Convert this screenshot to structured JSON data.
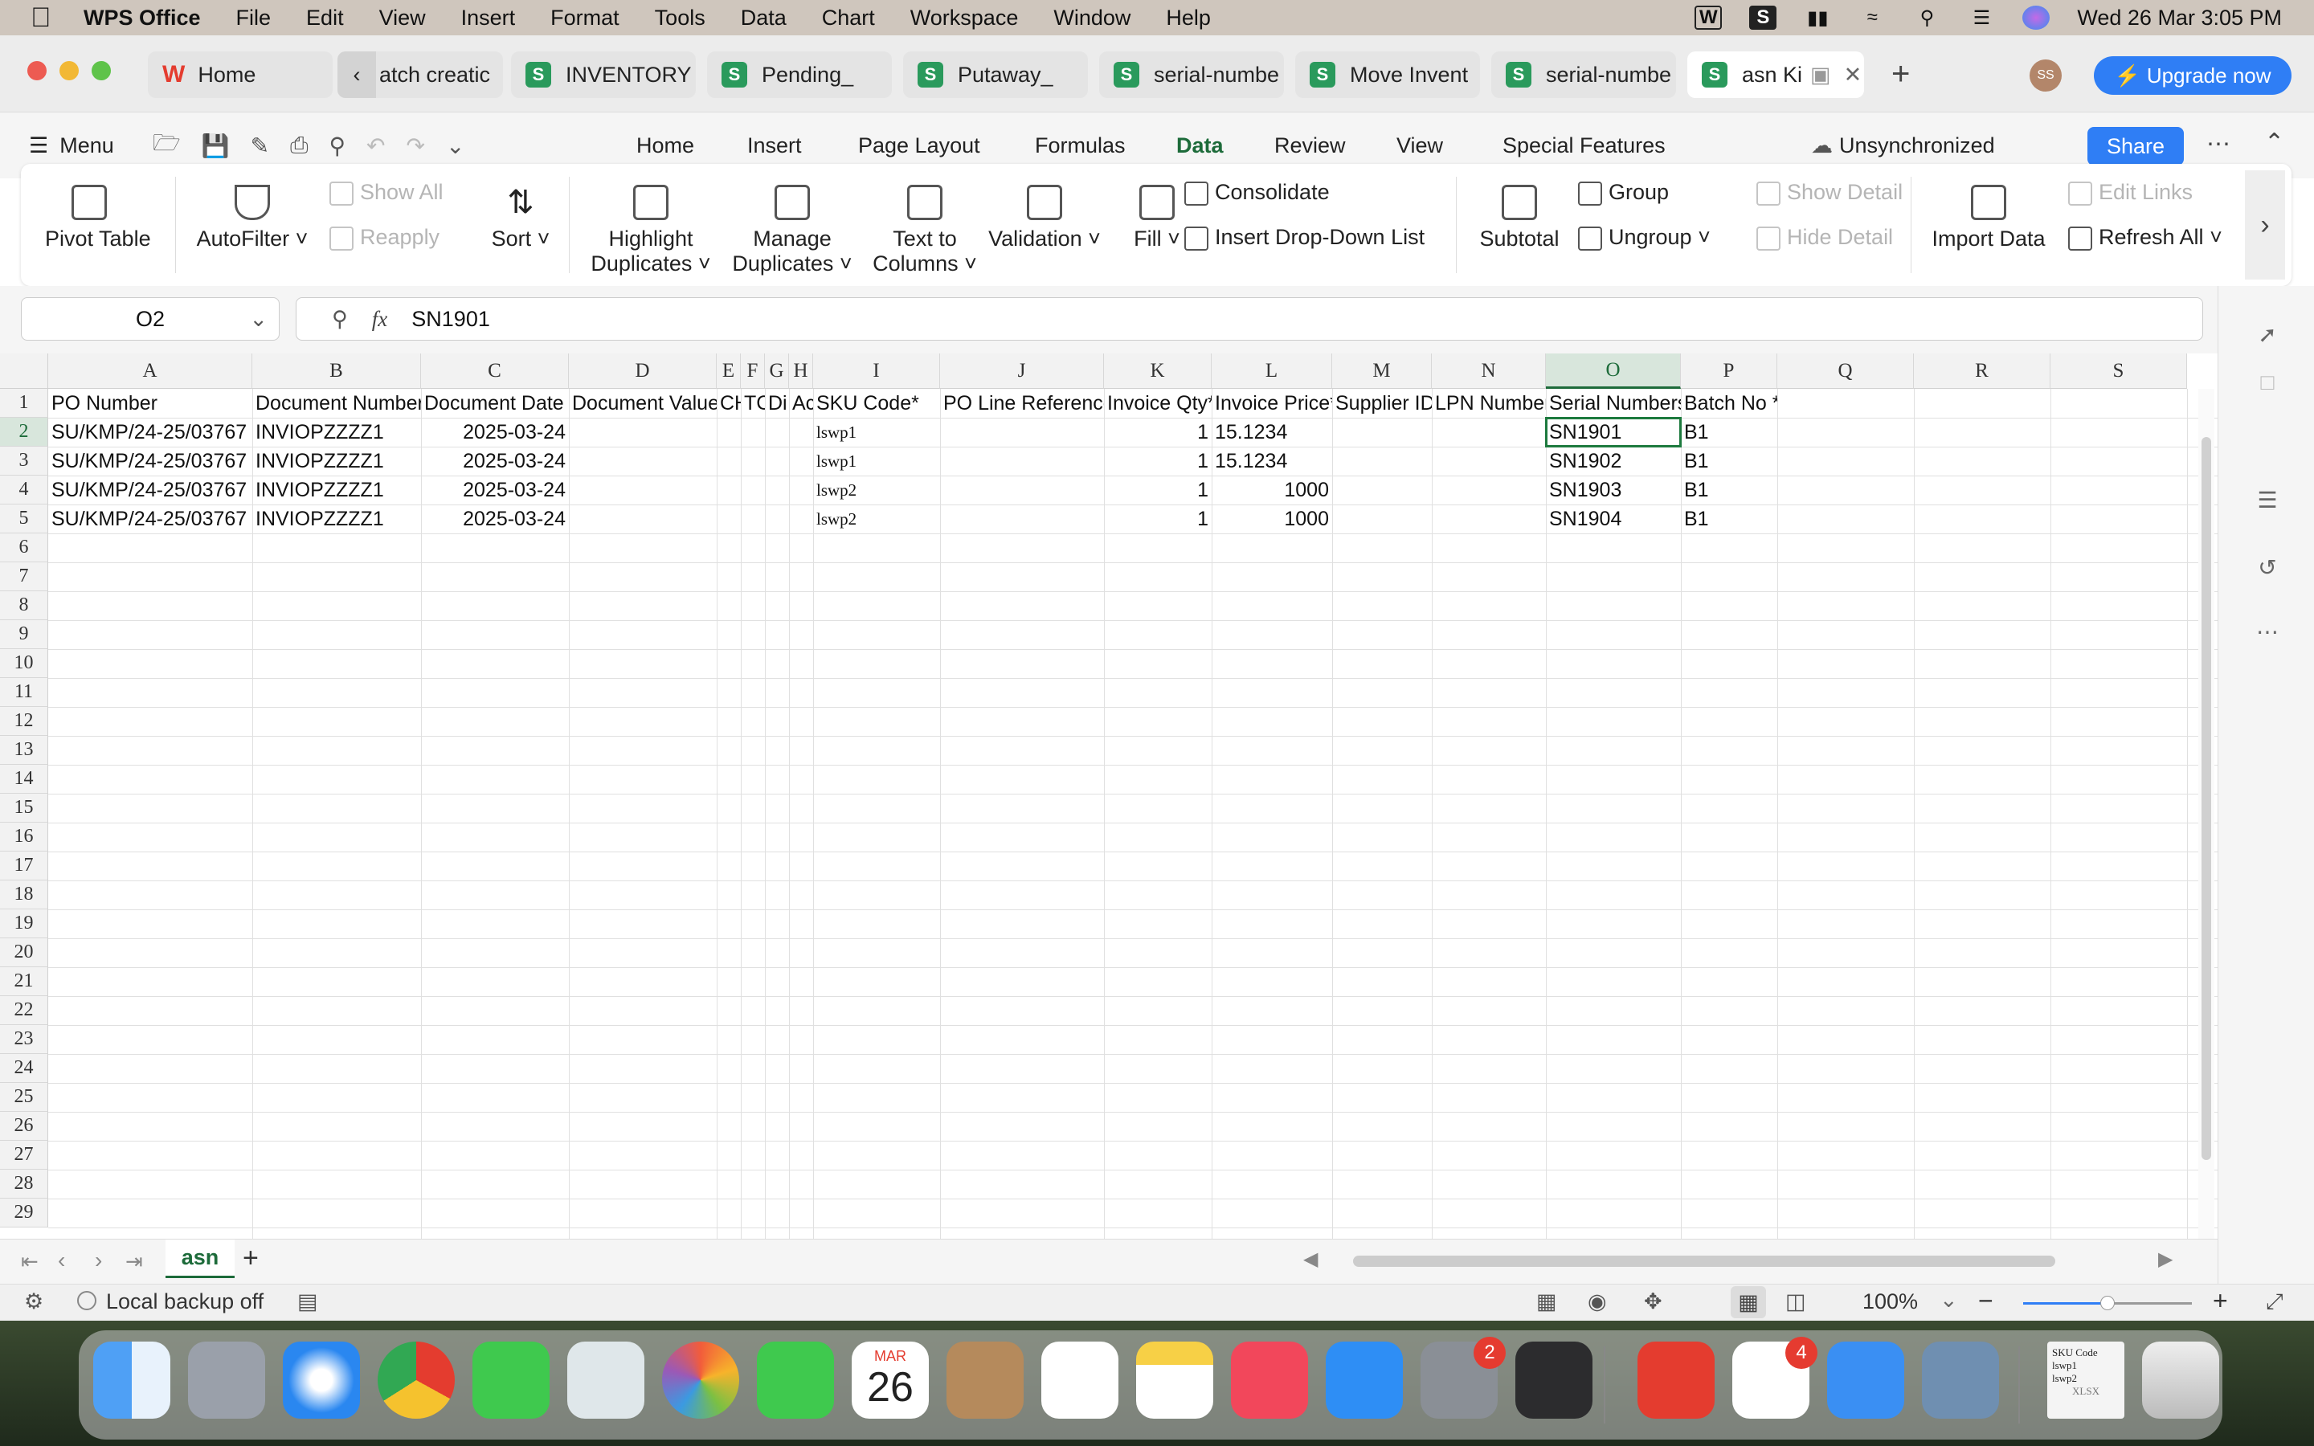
{
  "menubar": {
    "app_name": "WPS Office",
    "items": [
      "File",
      "Edit",
      "View",
      "Insert",
      "Format",
      "Tools",
      "Data",
      "Chart",
      "Workspace",
      "Window",
      "Help"
    ],
    "datetime": "Wed 26 Mar  3:05 PM"
  },
  "tabs": [
    {
      "label": "Home"
    },
    {
      "label": "atch creatic"
    },
    {
      "label": "INVENTORY"
    },
    {
      "label": "Pending_"
    },
    {
      "label": "Putaway_"
    },
    {
      "label": "serial-numbe"
    },
    {
      "label": "Move Invent"
    },
    {
      "label": "serial-numbe"
    },
    {
      "label": "asn Ki"
    }
  ],
  "account": {
    "avatar": "SS",
    "upgrade": "Upgrade now"
  },
  "toolbar": {
    "menu": "Menu",
    "ribbon_tabs": [
      "Home",
      "Insert",
      "Page Layout",
      "Formulas",
      "Data",
      "Review",
      "View",
      "Special Features"
    ],
    "sync_status": "Unsynchronized",
    "share": "Share"
  },
  "ribbon": {
    "pivot": "Pivot Table",
    "autofilter": "AutoFilter",
    "show_all": "Show All",
    "reapply": "Reapply",
    "sort": "Sort",
    "highlight_1": "Highlight",
    "highlight_2": "Duplicates",
    "manage_1": "Manage",
    "manage_2": "Duplicates",
    "text_1": "Text to",
    "text_2": "Columns",
    "validation": "Validation",
    "fill": "Fill",
    "consolidate": "Consolidate",
    "dropdown": "Insert Drop-Down List",
    "subtotal": "Subtotal",
    "group": "Group",
    "ungroup": "Ungroup",
    "show_detail": "Show Detail",
    "hide_detail": "Hide Detail",
    "import": "Import Data",
    "edit_links": "Edit Links",
    "refresh": "Refresh All"
  },
  "formula_bar": {
    "cell_ref": "O2",
    "fx": "fx",
    "content": "SN1901"
  },
  "columns": [
    "A",
    "B",
    "C",
    "D",
    "E",
    "F",
    "G",
    "H",
    "I",
    "J",
    "K",
    "L",
    "M",
    "N",
    "O",
    "P",
    "Q",
    "R",
    "S"
  ],
  "rows": [
    "1",
    "2",
    "3",
    "4",
    "5",
    "6",
    "7",
    "8",
    "9",
    "10",
    "11",
    "12",
    "13",
    "14",
    "15",
    "16",
    "17",
    "18",
    "19",
    "20",
    "21",
    "22",
    "23",
    "24",
    "25",
    "26",
    "27",
    "28",
    "29"
  ],
  "headers": {
    "A": "PO Number",
    "B": "Document Number",
    "C": "Document Date *",
    "D": "Document Value*",
    "E": "CH",
    "F": "TC",
    "G": "Di",
    "H": "Ac",
    "I": "SKU Code*",
    "J": "PO Line Reference",
    "K": "Invoice Qty*",
    "L": "Invoice Price*",
    "M": "Supplier ID",
    "N": "LPN Number",
    "O": "Serial Numbers",
    "P": "Batch No *"
  },
  "data_rows": [
    {
      "A": "SU/KMP/24-25/03767",
      "B": "INVIOPZZZZ1",
      "C": "2025-03-24",
      "I": "lswp1",
      "K": "1",
      "L": "15.1234",
      "O": "SN1901",
      "P": "B1"
    },
    {
      "A": "SU/KMP/24-25/03767",
      "B": "INVIOPZZZZ1",
      "C": "2025-03-24",
      "I": "lswp1",
      "K": "1",
      "L": "15.1234",
      "O": "SN1902",
      "P": "B1"
    },
    {
      "A": "SU/KMP/24-25/03767",
      "B": "INVIOPZZZZ1",
      "C": "2025-03-24",
      "I": "lswp2",
      "K": "1",
      "L": "1000",
      "O": "SN1903",
      "P": "B1"
    },
    {
      "A": "SU/KMP/24-25/03767",
      "B": "INVIOPZZZZ1",
      "C": "2025-03-24",
      "I": "lswp2",
      "K": "1",
      "L": "1000",
      "O": "SN1904",
      "P": "B1"
    }
  ],
  "sheet_tab": "asn",
  "status": {
    "backup": "Local backup off",
    "zoom": "100%",
    "zoom_level": 0.5
  },
  "dock": {
    "calendar_month": "MAR",
    "calendar_day": "26",
    "settings_badge": "2",
    "slack_badge": "4",
    "file_thumb_line1": "SKU Code",
    "file_thumb_line2": "lswp1",
    "file_thumb_line3": "lswp2",
    "file_thumb_ext": "XLSX"
  }
}
